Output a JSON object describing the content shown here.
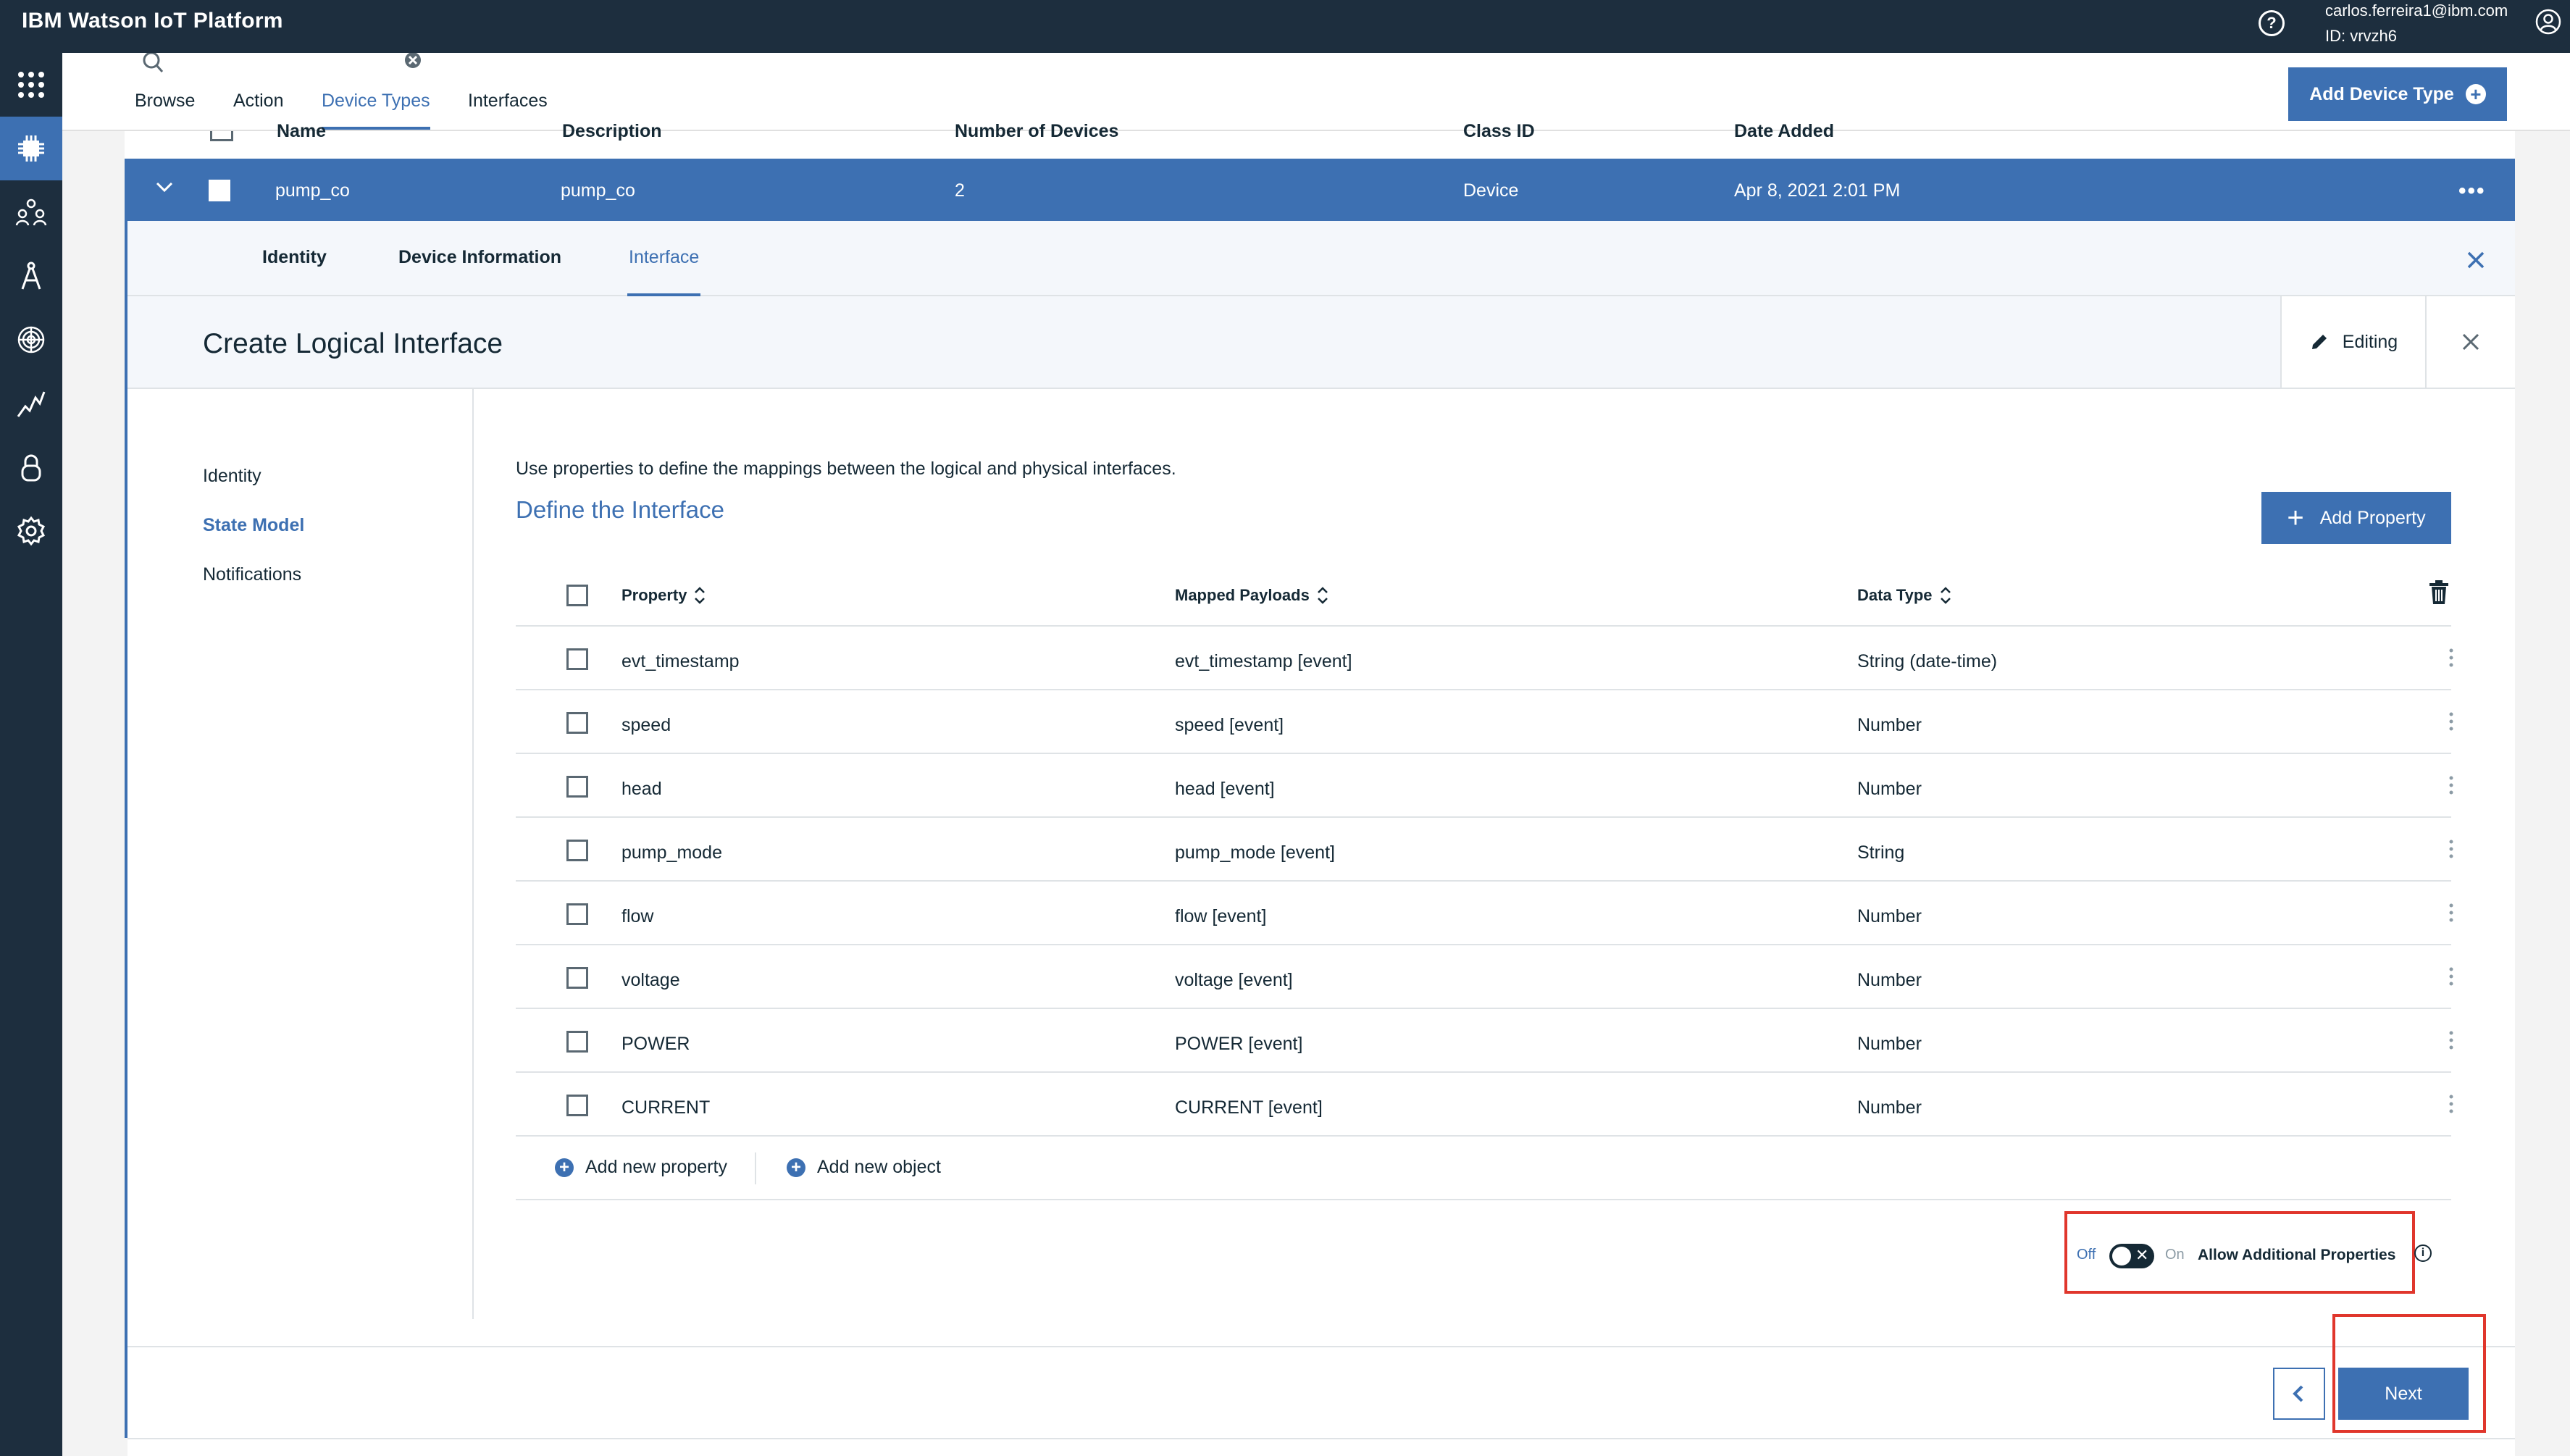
{
  "topbar": {
    "brand": "IBM Watson IoT Platform",
    "user_email": "carlos.ferreira1@ibm.com",
    "user_id": "ID: vrvzh6",
    "help_icon": "help-icon",
    "user_icon": "user-icon"
  },
  "sidebar": {
    "items": [
      {
        "icon": "apps-grid-icon"
      },
      {
        "icon": "devices-chip-icon",
        "active": true
      },
      {
        "icon": "members-icon"
      },
      {
        "icon": "apps-compass-icon"
      },
      {
        "icon": "security-fingerprint-icon"
      },
      {
        "icon": "usage-chart-icon"
      },
      {
        "icon": "rules-lock-icon"
      },
      {
        "icon": "settings-gear-icon"
      }
    ]
  },
  "subnav": {
    "tabs": [
      "Browse",
      "Action",
      "Device Types",
      "Interfaces"
    ],
    "active_tab": "Device Types",
    "add_button": "Add Device Type"
  },
  "table_header": {
    "name": "Name",
    "description": "Description",
    "num_devices": "Number of Devices",
    "class_id": "Class ID",
    "date_added": "Date Added"
  },
  "selected_row": {
    "name": "pump_co",
    "description": "pump_co",
    "num_devices": "2",
    "class_id": "Device",
    "date_added": "Apr 8, 2021 2:01 PM",
    "menu": "•••"
  },
  "detail_tabs": [
    "Identity",
    "Device Information",
    "Interface"
  ],
  "detail_active_tab": "Interface",
  "create": {
    "title": "Create Logical Interface",
    "editing_label": "Editing"
  },
  "steps": [
    "Identity",
    "State Model",
    "Notifications"
  ],
  "active_step": "State Model",
  "form": {
    "intro": "Use properties to define the mappings between the logical and physical interfaces.",
    "section_title": "Define the Interface",
    "add_property_button": "Add Property",
    "columns": {
      "property": "Property",
      "mapped": "Mapped Payloads",
      "data_type": "Data Type"
    },
    "rows": [
      {
        "property": "evt_timestamp",
        "mapped": "evt_timestamp [event]",
        "type": "String (date-time)"
      },
      {
        "property": "speed",
        "mapped": "speed [event]",
        "type": "Number"
      },
      {
        "property": "head",
        "mapped": "head [event]",
        "type": "Number"
      },
      {
        "property": "pump_mode",
        "mapped": "pump_mode [event]",
        "type": "String"
      },
      {
        "property": "flow",
        "mapped": "flow [event]",
        "type": "Number"
      },
      {
        "property": "voltage",
        "mapped": "voltage [event]",
        "type": "Number"
      },
      {
        "property": "POWER",
        "mapped": "POWER [event]",
        "type": "Number"
      },
      {
        "property": "CURRENT",
        "mapped": "CURRENT [event]",
        "type": "Number"
      }
    ],
    "add_new_property": "Add new property",
    "add_new_object": "Add new object"
  },
  "toggle": {
    "off_label": "Off",
    "on_label": "On",
    "label": "Allow Additional Properties",
    "state": "off"
  },
  "footer": {
    "next_button": "Next"
  },
  "colors": {
    "topbar": "#1d2e3e",
    "accent": "#3d70b2",
    "highlight": "#e0362c"
  }
}
